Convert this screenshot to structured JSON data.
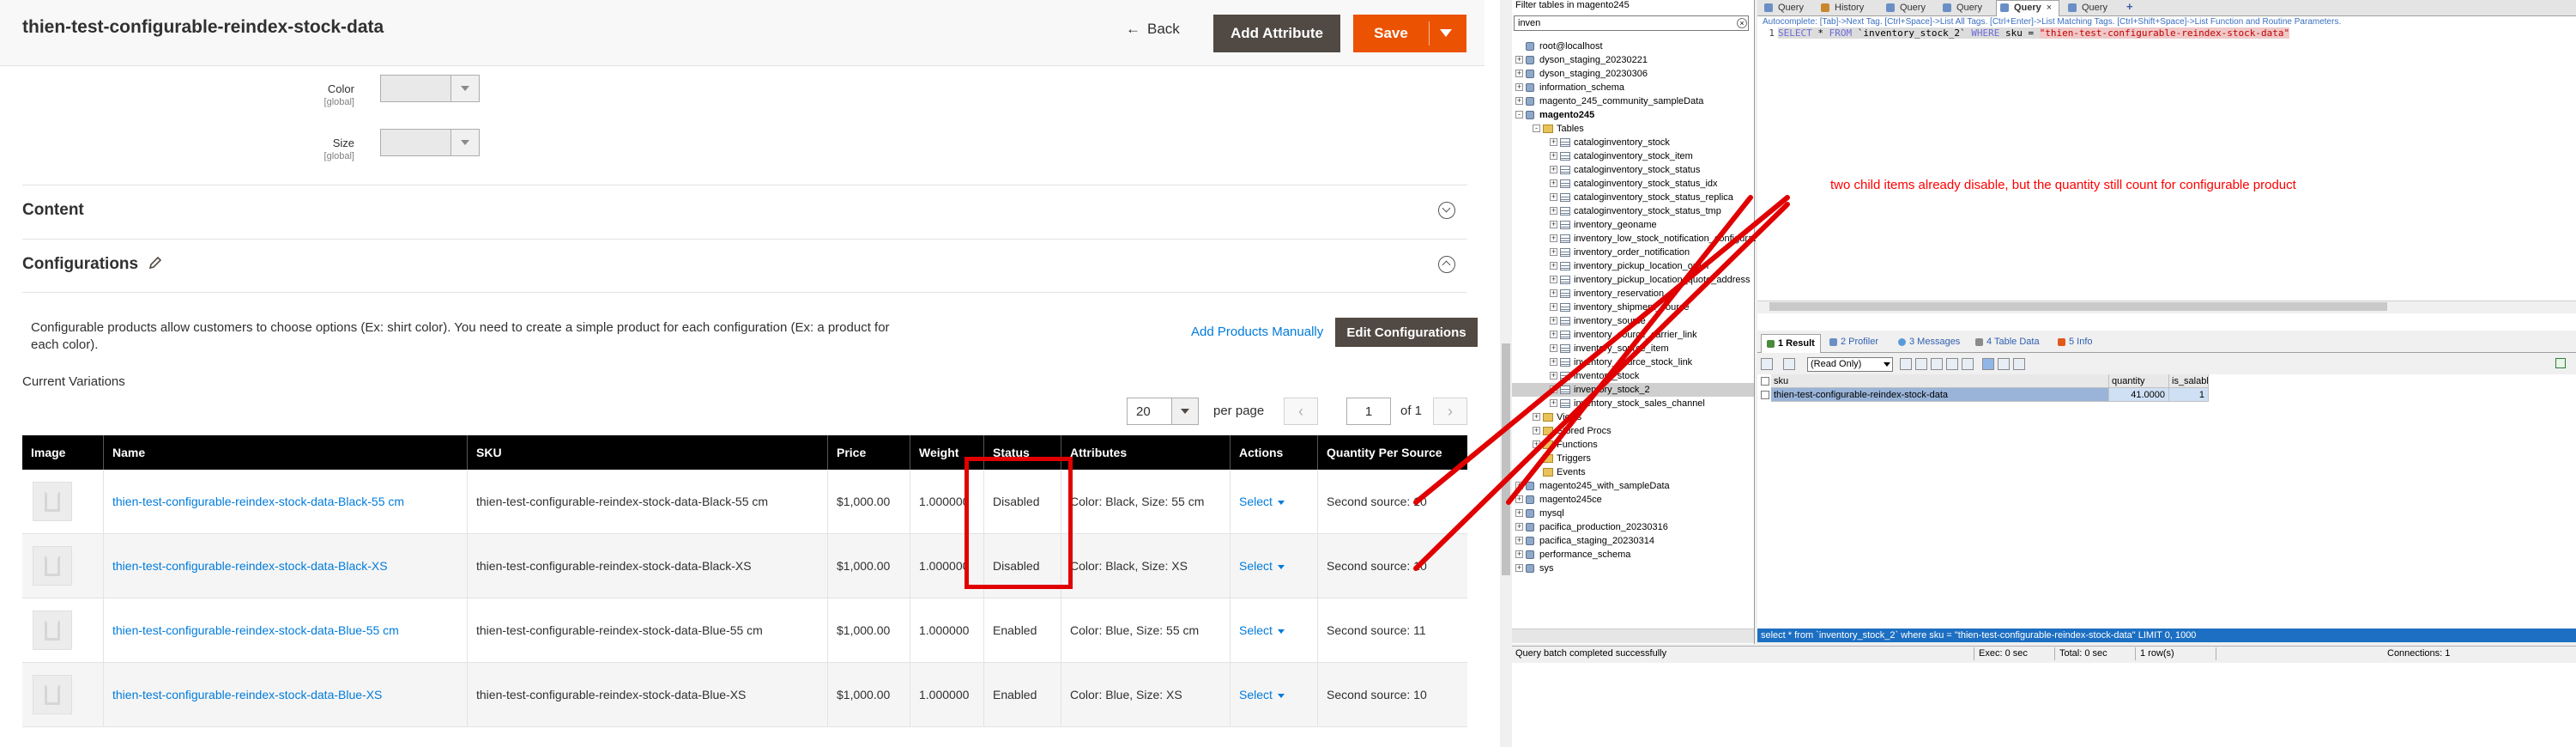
{
  "admin": {
    "page_title": "thien-test-configurable-reindex-stock-data",
    "back_label": "Back",
    "add_attribute_label": "Add Attribute",
    "save_label": "Save",
    "attributes": [
      {
        "label": "Color",
        "scope": "[global]"
      },
      {
        "label": "Size",
        "scope": "[global]"
      }
    ],
    "content_section_title": "Content",
    "configurations_section_title": "Configurations",
    "config_description": "Configurable products allow customers to choose options (Ex: shirt color). You need to create a simple product for each configuration (Ex: a product for each color).",
    "add_products_manually_label": "Add Products Manually",
    "edit_configurations_label": "Edit Configurations",
    "current_variations_label": "Current Variations",
    "per_page_value": "20",
    "per_page_label": "per page",
    "page_value": "1",
    "page_of_label": "of 1",
    "grid_columns": [
      "Image",
      "Name",
      "SKU",
      "Price",
      "Weight",
      "Status",
      "Attributes",
      "Actions",
      "Quantity Per Source"
    ],
    "grid_rows": [
      {
        "name": "thien-test-configurable-reindex-stock-data-Black-55 cm",
        "sku": "thien-test-configurable-reindex-stock-data-Black-55 cm",
        "price": "$1,000.00",
        "weight": "1.000000",
        "status": "Disabled",
        "attributes": "Color: Black, Size: 55 cm",
        "action": "Select",
        "qty": "Second source: 10"
      },
      {
        "name": "thien-test-configurable-reindex-stock-data-Black-XS",
        "sku": "thien-test-configurable-reindex-stock-data-Black-XS",
        "price": "$1,000.00",
        "weight": "1.000000",
        "status": "Disabled",
        "attributes": "Color: Black, Size: XS",
        "action": "Select",
        "qty": "Second source: 10"
      },
      {
        "name": "thien-test-configurable-reindex-stock-data-Blue-55 cm",
        "sku": "thien-test-configurable-reindex-stock-data-Blue-55 cm",
        "price": "$1,000.00",
        "weight": "1.000000",
        "status": "Enabled",
        "attributes": "Color: Blue, Size: 55 cm",
        "action": "Select",
        "qty": "Second source: 11"
      },
      {
        "name": "thien-test-configurable-reindex-stock-data-Blue-XS",
        "sku": "thien-test-configurable-reindex-stock-data-Blue-XS",
        "price": "$1,000.00",
        "weight": "1.000000",
        "status": "Enabled",
        "attributes": "Color: Blue, Size: XS",
        "action": "Select",
        "qty": "Second source: 10"
      }
    ]
  },
  "annotation": {
    "text": "two child items already disable, but the quantity still count for configurable product",
    "color": "#ff0000"
  },
  "sqlyog": {
    "filter_label": "Filter tables in magento245",
    "filter_value": "inven",
    "tree": [
      {
        "text": "root@localhost",
        "level": 0,
        "kind": "server"
      },
      {
        "text": "dyson_staging_20230221",
        "level": 0,
        "kind": "db",
        "exp": "+"
      },
      {
        "text": "dyson_staging_20230306",
        "level": 0,
        "kind": "db",
        "exp": "+"
      },
      {
        "text": "information_schema",
        "level": 0,
        "kind": "db",
        "exp": "+"
      },
      {
        "text": "magento_245_community_sampleData",
        "level": 0,
        "kind": "db",
        "exp": "+"
      },
      {
        "text": "magento245",
        "level": 0,
        "kind": "db",
        "exp": "-",
        "bold": true
      },
      {
        "text": "Tables",
        "level": 1,
        "kind": "folder",
        "exp": "-"
      },
      {
        "text": "cataloginventory_stock",
        "level": 2,
        "kind": "table",
        "exp": "+"
      },
      {
        "text": "cataloginventory_stock_item",
        "level": 2,
        "kind": "table",
        "exp": "+"
      },
      {
        "text": "cataloginventory_stock_status",
        "level": 2,
        "kind": "table",
        "exp": "+"
      },
      {
        "text": "cataloginventory_stock_status_idx",
        "level": 2,
        "kind": "table",
        "exp": "+"
      },
      {
        "text": "cataloginventory_stock_status_replica",
        "level": 2,
        "kind": "table",
        "exp": "+"
      },
      {
        "text": "cataloginventory_stock_status_tmp",
        "level": 2,
        "kind": "table",
        "exp": "+"
      },
      {
        "text": "inventory_geoname",
        "level": 2,
        "kind": "table",
        "exp": "+"
      },
      {
        "text": "inventory_low_stock_notification_configurat",
        "level": 2,
        "kind": "table",
        "exp": "+"
      },
      {
        "text": "inventory_order_notification",
        "level": 2,
        "kind": "table",
        "exp": "+"
      },
      {
        "text": "inventory_pickup_location_order",
        "level": 2,
        "kind": "table",
        "exp": "+"
      },
      {
        "text": "inventory_pickup_location_quote_address",
        "level": 2,
        "kind": "table",
        "exp": "+"
      },
      {
        "text": "inventory_reservation",
        "level": 2,
        "kind": "table",
        "exp": "+"
      },
      {
        "text": "inventory_shipment_source",
        "level": 2,
        "kind": "table",
        "exp": "+"
      },
      {
        "text": "inventory_source",
        "level": 2,
        "kind": "table",
        "exp": "+"
      },
      {
        "text": "inventory_source_carrier_link",
        "level": 2,
        "kind": "table",
        "exp": "+"
      },
      {
        "text": "inventory_source_item",
        "level": 2,
        "kind": "table",
        "exp": "+"
      },
      {
        "text": "inventory_source_stock_link",
        "level": 2,
        "kind": "table",
        "exp": "+"
      },
      {
        "text": "inventory_stock",
        "level": 2,
        "kind": "table",
        "exp": "+"
      },
      {
        "text": "inventory_stock_2",
        "level": 2,
        "kind": "table",
        "exp": "+",
        "selected": true
      },
      {
        "text": "inventory_stock_sales_channel",
        "level": 2,
        "kind": "table",
        "exp": "+"
      },
      {
        "text": "Views",
        "level": 1,
        "kind": "folder",
        "exp": "+"
      },
      {
        "text": "Stored Procs",
        "level": 1,
        "kind": "folder",
        "exp": "+"
      },
      {
        "text": "Functions",
        "level": 1,
        "kind": "folder",
        "exp": "+"
      },
      {
        "text": "Triggers",
        "level": 1,
        "kind": "folder"
      },
      {
        "text": "Events",
        "level": 1,
        "kind": "folder"
      },
      {
        "text": "magento245_with_sampleData",
        "level": 0,
        "kind": "db",
        "exp": "+"
      },
      {
        "text": "magento245ce",
        "level": 0,
        "kind": "db",
        "exp": "+"
      },
      {
        "text": "mysql",
        "level": 0,
        "kind": "db",
        "exp": "+"
      },
      {
        "text": "pacifica_production_20230316",
        "level": 0,
        "kind": "db",
        "exp": "+"
      },
      {
        "text": "pacifica_staging_20230314",
        "level": 0,
        "kind": "db",
        "exp": "+"
      },
      {
        "text": "performance_schema",
        "level": 0,
        "kind": "db",
        "exp": "+"
      },
      {
        "text": "sys",
        "level": 0,
        "kind": "db",
        "exp": "+"
      }
    ],
    "tabs": [
      "Query",
      "History",
      "Query",
      "Query",
      "Query",
      "Query"
    ],
    "active_tab_index": 4,
    "autocomplete_hint": "Autocomplete: [Tab]->Next Tag. [Ctrl+Space]->List All Tags. [Ctrl+Enter]->List Matching Tags. [Ctrl+Shift+Space]->List Function and Routine Parameters.",
    "sql": {
      "line_no": "1",
      "select_kw": "SELECT",
      "star": " * ",
      "from_kw": "FROM",
      "table": " `inventory_stock_2` ",
      "where_kw": "WHERE",
      "col": " sku = ",
      "value": "\"thien-test-configurable-reindex-stock-data\""
    },
    "result_tabs": [
      "1 Result",
      "2 Profiler",
      "3 Messages",
      "4 Table Data",
      "5 Info"
    ],
    "readonly_label": "(Read Only)",
    "result_columns": [
      "sku",
      "quantity",
      "is_salable"
    ],
    "result_rows": [
      {
        "sku": "thien-test-configurable-reindex-stock-data",
        "quantity": "41.0000",
        "is_salable": "1"
      }
    ],
    "status_query": "select * from `inventory_stock_2` where sku = \"thien-test-configurable-reindex-stock-data\" LIMIT 0, 1000",
    "status_bar": {
      "message": "Query batch completed successfully",
      "exec": "Exec: 0 sec",
      "total": "Total: 0 sec",
      "rows": "1 row(s)",
      "connections": "Connections: 1"
    }
  },
  "colors": {
    "brand_orange": "#eb5202",
    "dark_button": "#514943",
    "link_blue": "#007bdb",
    "annotation_red": "#e00000"
  }
}
